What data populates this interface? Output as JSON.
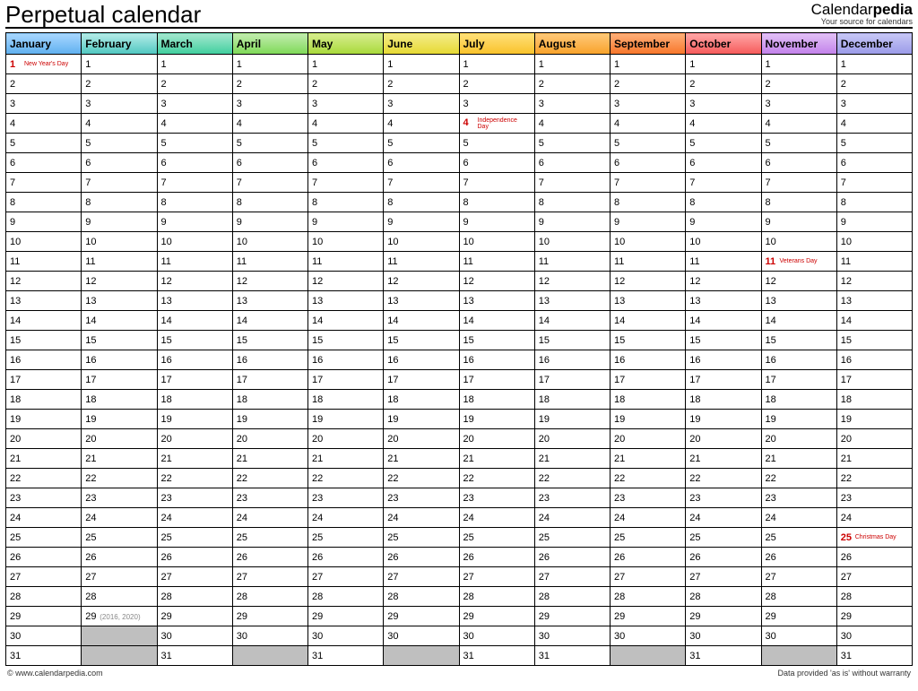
{
  "title": "Perpetual calendar",
  "brand_main": "Calendar",
  "brand_bold": "pedia",
  "brand_sub": "Your source for calendars",
  "footer_left": "© www.calendarpedia.com",
  "footer_right": "Data provided 'as is' without warranty",
  "months": [
    {
      "name": "January",
      "days": 31,
      "holidays": {
        "1": "New Year's Day"
      }
    },
    {
      "name": "February",
      "days": 29,
      "holidays": {},
      "notes": {
        "29": "(2016, 2020)"
      }
    },
    {
      "name": "March",
      "days": 31,
      "holidays": {}
    },
    {
      "name": "April",
      "days": 30,
      "holidays": {}
    },
    {
      "name": "May",
      "days": 31,
      "holidays": {}
    },
    {
      "name": "June",
      "days": 30,
      "holidays": {}
    },
    {
      "name": "July",
      "days": 31,
      "holidays": {
        "4": "Independence Day"
      }
    },
    {
      "name": "August",
      "days": 31,
      "holidays": {}
    },
    {
      "name": "September",
      "days": 30,
      "holidays": {}
    },
    {
      "name": "October",
      "days": 31,
      "holidays": {}
    },
    {
      "name": "November",
      "days": 30,
      "holidays": {
        "11": "Veterans Day"
      }
    },
    {
      "name": "December",
      "days": 31,
      "holidays": {
        "25": "Christmas Day"
      }
    }
  ],
  "max_days": 31
}
